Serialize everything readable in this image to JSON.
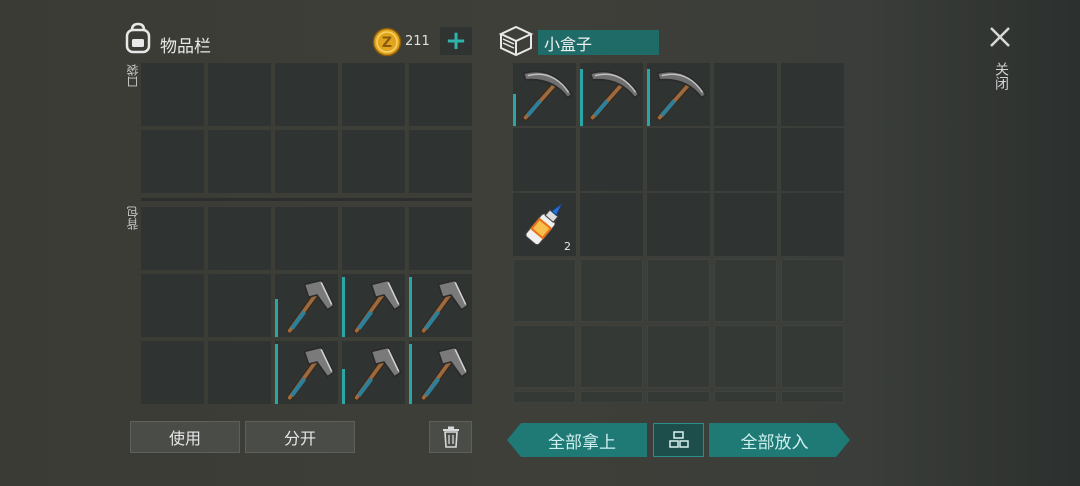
{
  "inventory": {
    "title": "物品栏",
    "coins": "211",
    "pocket_label": "口袋",
    "backpack_label": "背包"
  },
  "container": {
    "title": "小盒子",
    "glue_count": "2"
  },
  "buttons": {
    "use": "使用",
    "split": "分开",
    "take_all": "全部拿上",
    "put_all": "全部放入"
  },
  "close": {
    "label": "关闭"
  },
  "colors": {
    "accent_teal": "#1f7a76",
    "durability_bar": "#2aa6a6",
    "coin_gold": "#e0a51c"
  },
  "items": {
    "pickaxe_durability": [
      0.5,
      0.9,
      0.9
    ],
    "hatchet_durability": [
      0.6,
      0.95,
      0.95,
      0.95,
      0.55,
      0.95
    ]
  }
}
